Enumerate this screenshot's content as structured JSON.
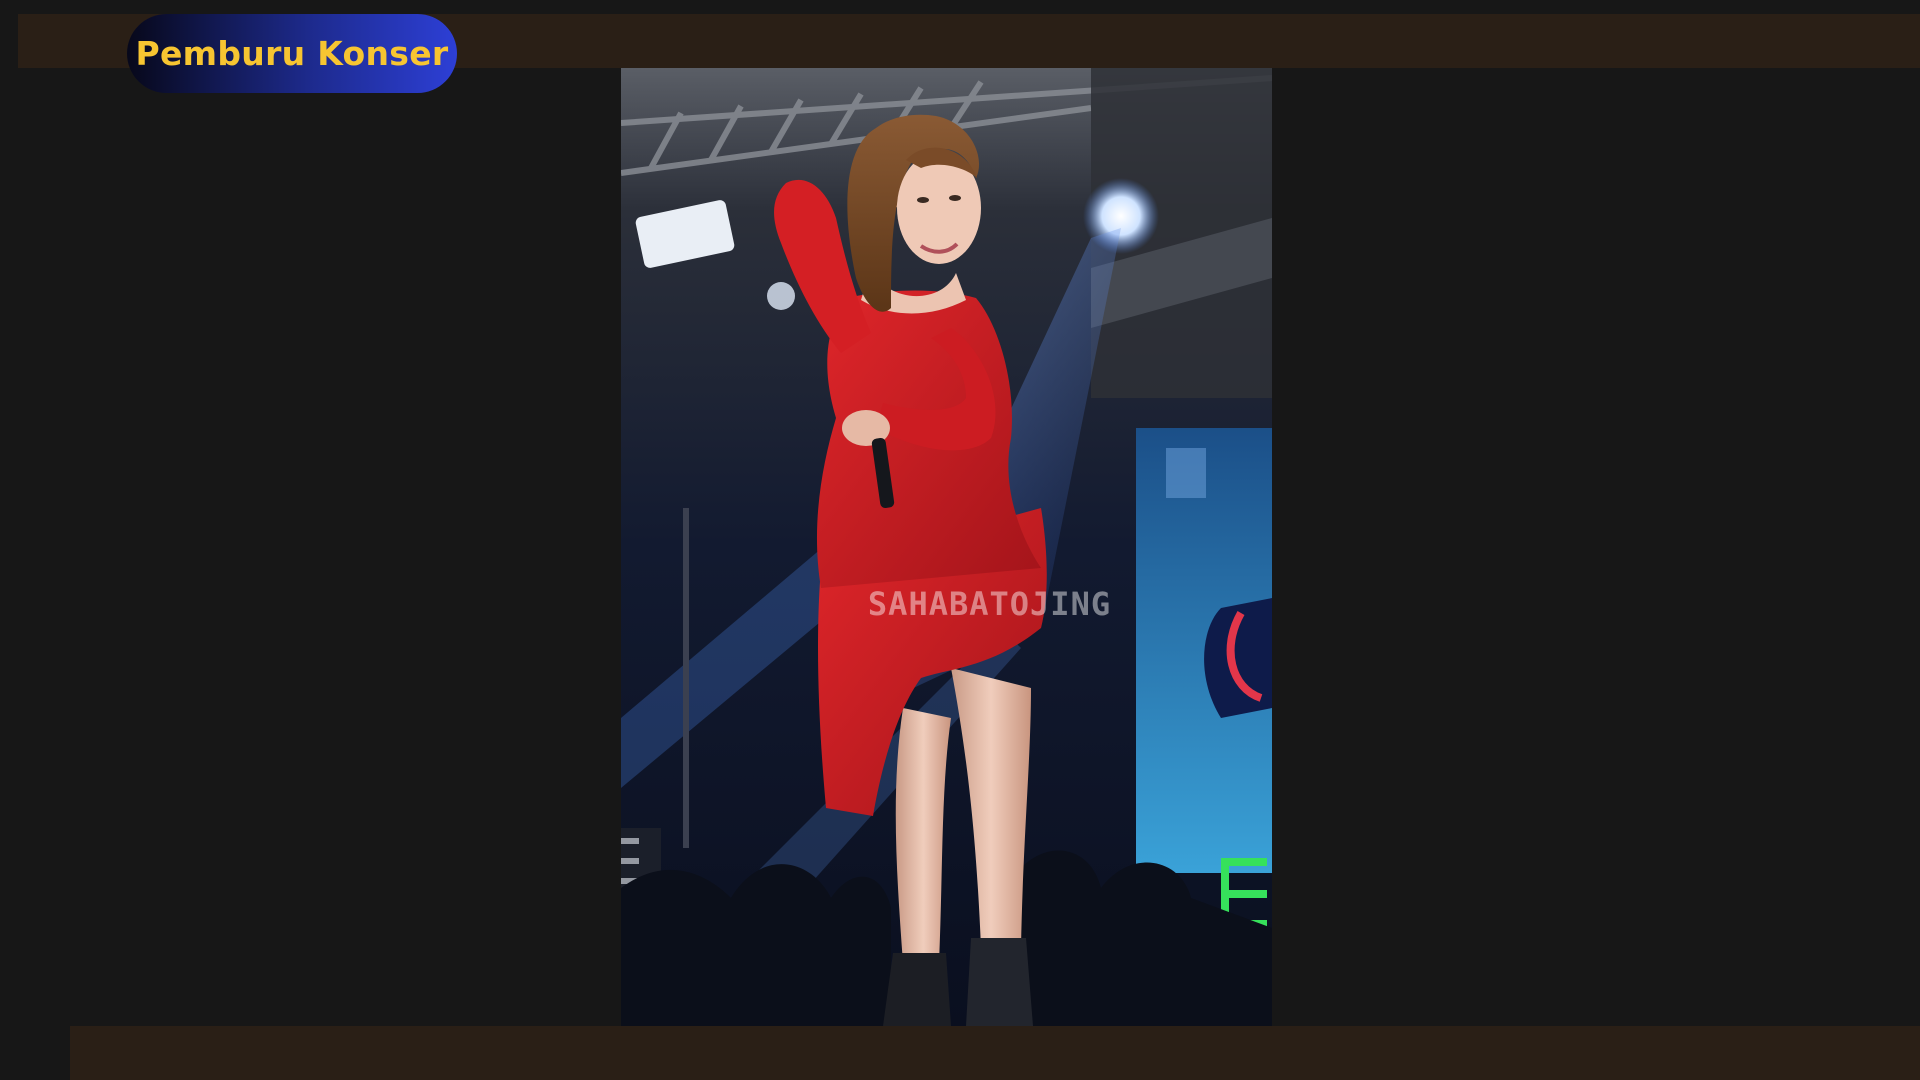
{
  "channel": {
    "name": "Pemburu Konser"
  },
  "video": {
    "watermark": "SAHABATOJING"
  },
  "colors": {
    "page_background": "#171717",
    "bar": "#2a1f16",
    "channel_text": "#f7c531",
    "dress": "#c41d21"
  }
}
